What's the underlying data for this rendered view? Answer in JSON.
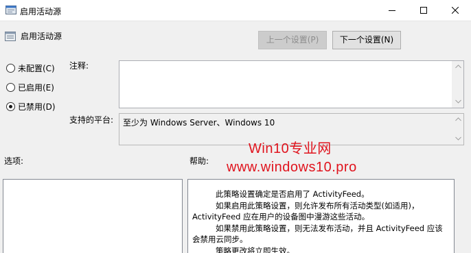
{
  "window": {
    "title": "启用活动源"
  },
  "header": {
    "title": "启用活动源",
    "prev_button": "上一个设置(P)",
    "next_button": "下一个设置(N)"
  },
  "state_options": [
    {
      "label": "未配置(C)",
      "checked": false
    },
    {
      "label": "已启用(E)",
      "checked": false
    },
    {
      "label": "已禁用(D)",
      "checked": true
    }
  ],
  "comment": {
    "label": "注释:",
    "value": ""
  },
  "platform": {
    "label": "支持的平台:",
    "value": "至少为 Windows Server、Windows 10"
  },
  "options": {
    "label": "选项:"
  },
  "help": {
    "label": "帮助:",
    "paragraphs": [
      "此策略设置确定是否启用了 ActivityFeed。",
      "如果启用此策略设置，则允许发布所有活动类型(如适用)，",
      "ActivityFeed 应在用户的设备图中漫游这些活动。",
      "如果禁用此策略设置，则无法发布活动，并且 ActivityFeed 应该",
      "会禁用云同步。",
      "策略更改将立即生效。"
    ]
  },
  "watermark": {
    "line1": "Win10专业网",
    "line2": "www.windows10.pro"
  },
  "colors": {
    "watermark": "#e0131d",
    "window_bg": "#f0f0f0"
  }
}
